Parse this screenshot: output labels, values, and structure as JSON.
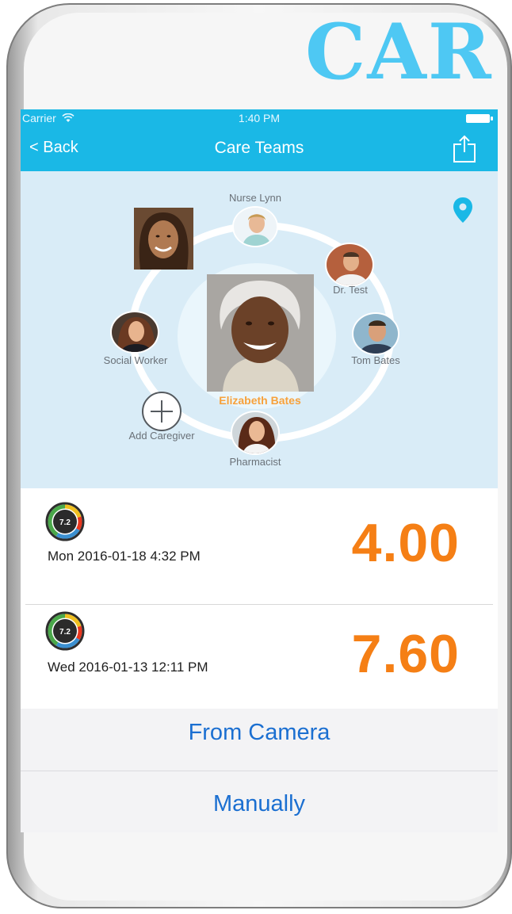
{
  "brand": {
    "text": "CAR"
  },
  "status_bar": {
    "carrier": "Carrier",
    "time": "1:40 PM"
  },
  "nav": {
    "back_label": "< Back",
    "title": "Care Teams"
  },
  "care_team": {
    "center": {
      "name": "Elizabeth Bates"
    },
    "members": [
      {
        "label": "Nurse Lynn"
      },
      {
        "label": "Dr. Test"
      },
      {
        "label": "Tom Bates"
      },
      {
        "label": "Pharmacist"
      },
      {
        "label": "Social Worker"
      }
    ],
    "add_label": "Add Caregiver"
  },
  "readings": [
    {
      "gauge_value": "7.2",
      "date": "Mon 2016-01-18 4:32 PM",
      "value": "4.00"
    },
    {
      "gauge_value": "7.2",
      "date": "Wed 2016-01-13 12:11 PM",
      "value": "7.60"
    }
  ],
  "action_sheet": {
    "camera_label": "From Camera",
    "manual_label": "Manually"
  },
  "colors": {
    "accent": "#1ab8e6",
    "value_orange": "#f57f15",
    "center_name": "#f7a13b",
    "action_blue": "#1b6fd1",
    "brand": "#4ec8f3"
  },
  "icons": {
    "share": "share-icon",
    "location": "location-pin-icon",
    "add": "plus-circle-icon",
    "wifi": "wifi-icon",
    "battery": "battery-icon",
    "gauge": "gauge-icon"
  }
}
